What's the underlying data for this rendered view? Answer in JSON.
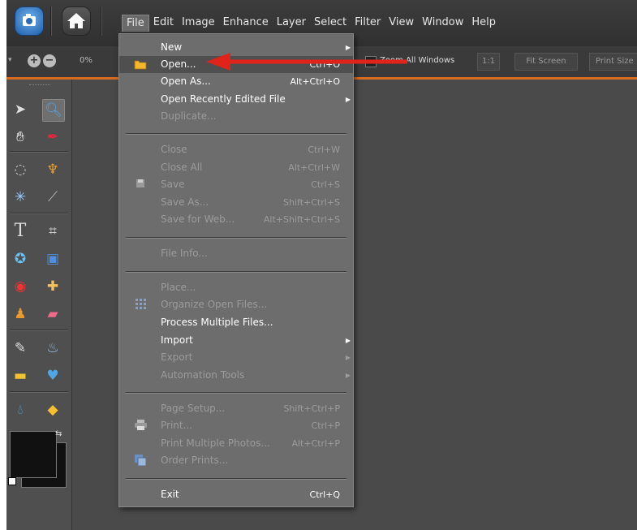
{
  "menubar": {
    "items": [
      "File",
      "Edit",
      "Image",
      "Enhance",
      "Layer",
      "Select",
      "Filter",
      "View",
      "Window",
      "Help"
    ],
    "active": "File",
    "organizer_icon": "camera-icon",
    "home_icon": "home-icon"
  },
  "optionsbar": {
    "zoom_percent": "0%",
    "zoom_all_windows": "Zoom All Windows",
    "one_to_one": "1:1",
    "fit_screen": "Fit Screen",
    "print_size": "Print Size"
  },
  "file_menu": {
    "items": [
      {
        "label": "New",
        "shortcut": "",
        "enabled": true,
        "submenu": true
      },
      {
        "label": "Open...",
        "shortcut": "Ctrl+O",
        "enabled": true,
        "highlighted": true,
        "icon": "folder-icon"
      },
      {
        "label": "Open As...",
        "shortcut": "Alt+Ctrl+O",
        "enabled": true
      },
      {
        "label": "Open Recently Edited File",
        "shortcut": "",
        "enabled": true,
        "submenu": true
      },
      {
        "label": "Duplicate...",
        "shortcut": "",
        "enabled": false
      },
      {
        "label": "Close",
        "shortcut": "Ctrl+W",
        "enabled": false
      },
      {
        "label": "Close All",
        "shortcut": "Alt+Ctrl+W",
        "enabled": false
      },
      {
        "label": "Save",
        "shortcut": "Ctrl+S",
        "enabled": false,
        "icon": "save-icon"
      },
      {
        "label": "Save As...",
        "shortcut": "Shift+Ctrl+S",
        "enabled": false
      },
      {
        "label": "Save for Web...",
        "shortcut": "Alt+Shift+Ctrl+S",
        "enabled": false
      },
      {
        "label": "File Info...",
        "shortcut": "",
        "enabled": false
      },
      {
        "label": "Place...",
        "shortcut": "",
        "enabled": false
      },
      {
        "label": "Organize Open Files...",
        "shortcut": "",
        "enabled": false,
        "icon": "organize-icon"
      },
      {
        "label": "Process Multiple Files...",
        "shortcut": "",
        "enabled": true
      },
      {
        "label": "Import",
        "shortcut": "",
        "enabled": true,
        "submenu": true
      },
      {
        "label": "Export",
        "shortcut": "",
        "enabled": false,
        "submenu": true
      },
      {
        "label": "Automation Tools",
        "shortcut": "",
        "enabled": false,
        "submenu": true
      },
      {
        "label": "Page Setup...",
        "shortcut": "Shift+Ctrl+P",
        "enabled": false
      },
      {
        "label": "Print...",
        "shortcut": "Ctrl+P",
        "enabled": false,
        "icon": "printer-icon"
      },
      {
        "label": "Print Multiple Photos...",
        "shortcut": "Alt+Ctrl+P",
        "enabled": false
      },
      {
        "label": "Order Prints...",
        "shortcut": "",
        "enabled": false,
        "icon": "order-prints-icon"
      },
      {
        "label": "Exit",
        "shortcut": "Ctrl+Q",
        "enabled": true
      }
    ]
  },
  "colors": {
    "accent": "#d76c20",
    "annotation_arrow": "#e0241b"
  }
}
